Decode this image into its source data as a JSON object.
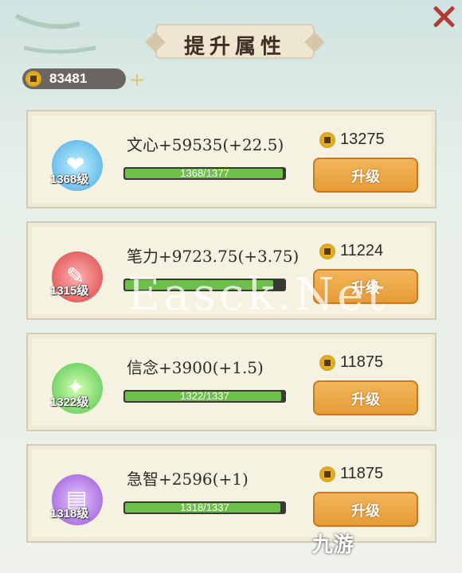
{
  "header": {
    "title": "提升属性"
  },
  "currency": {
    "value": "83481",
    "plus": "+"
  },
  "cards": [
    {
      "stat": "文心+59535(+22.5)",
      "level": "1368级",
      "progress": "1368/1377",
      "progress_fraction": 0.993,
      "cost": "13275",
      "button": "升级",
      "icon": "heart-icon",
      "color": "#5fb8e8"
    },
    {
      "stat": "笔力+9723.75(+3.75)",
      "level": "1315级",
      "progress": "",
      "progress_fraction": 0.95,
      "cost": "11224",
      "button": "升级",
      "icon": "brush-icon",
      "color": "#e05a5a"
    },
    {
      "stat": "信念+3900(+1.5)",
      "level": "1322级",
      "progress": "1322/1337",
      "progress_fraction": 0.989,
      "cost": "11875",
      "button": "升级",
      "icon": "scroll-icon",
      "color": "#6ccf62"
    },
    {
      "stat": "急智+2596(+1)",
      "level": "1318级",
      "progress": "1318/1337",
      "progress_fraction": 0.986,
      "cost": "11875",
      "button": "升级",
      "icon": "book-icon",
      "color": "#a66be0"
    }
  ],
  "watermark": "Easck.Net",
  "logo": "九游"
}
